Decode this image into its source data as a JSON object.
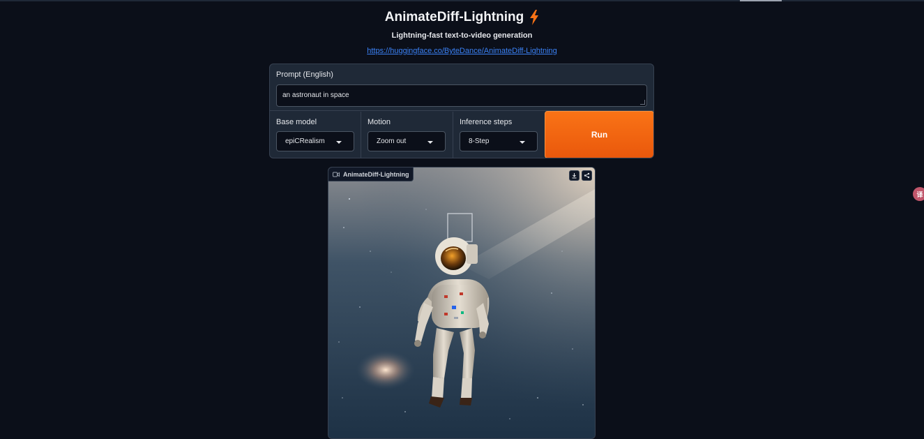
{
  "header": {
    "title": "AnimateDiff-Lightning",
    "subtitle": "Lightning-fast text-to-video generation",
    "link": "https://huggingface.co/ByteDance/AnimateDiff-Lightning"
  },
  "prompt": {
    "label": "Prompt (English)",
    "value": "an astronaut in space"
  },
  "options": {
    "base_model": {
      "label": "Base model",
      "value": "epiCRealism"
    },
    "motion": {
      "label": "Motion",
      "value": "Zoom out"
    },
    "steps": {
      "label": "Inference steps",
      "value": "8-Step"
    }
  },
  "run_label": "Run",
  "video": {
    "label": "AnimateDiff-Lightning",
    "icons": [
      "video-icon",
      "download-icon",
      "share-icon"
    ]
  },
  "side_badge": "译",
  "colors": {
    "background": "#0b0f19",
    "panel": "#1f2937",
    "accent": "#f97316",
    "link": "#3b82f6"
  }
}
